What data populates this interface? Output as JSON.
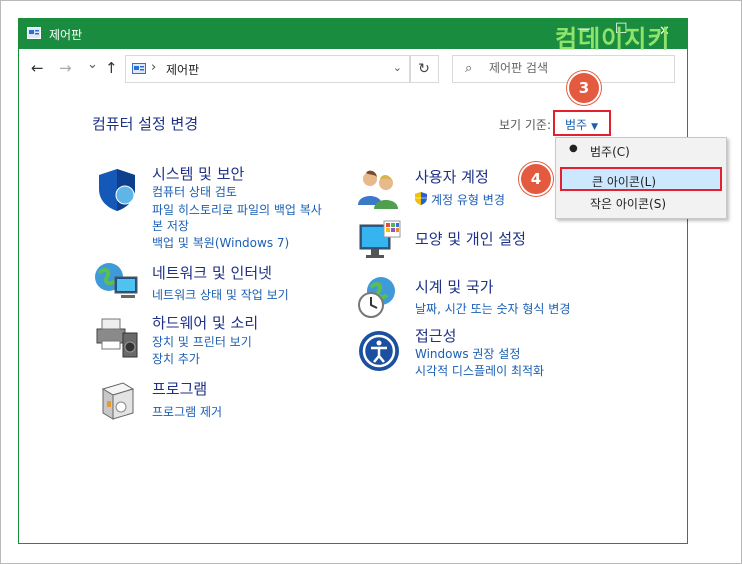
{
  "window": {
    "title": "제어판",
    "minimize": "—",
    "maximize": "☐",
    "close": "✕"
  },
  "watermark": "컴데이지키",
  "nav": {
    "back": "←",
    "forward": "→",
    "recent": "⌄",
    "up": "↑",
    "refresh": "↻",
    "path_sep": "›",
    "path": "제어판",
    "dropdown": "⌄"
  },
  "search": {
    "icon": "⌕",
    "placeholder": "제어판 검색"
  },
  "main": {
    "heading": "컴퓨터 설정 변경",
    "view_by_label": "보기 기준:",
    "view_by_value": "범주",
    "view_by_caret": "▼"
  },
  "menu": {
    "items": [
      {
        "label": "범주(C)",
        "selected": true
      },
      {
        "label": "큰 아이콘(L)",
        "highlighted": true
      },
      {
        "label": "작은 아이콘(S)"
      }
    ],
    "bullet": "●"
  },
  "badges": [
    "3",
    "4"
  ],
  "categories": {
    "system": {
      "title": "시스템 및 보안",
      "links": [
        "컴퓨터 상태 검토",
        "파일 히스토리로 파일의 백업 복사",
        "본 저장",
        "백업 및 복원(Windows 7)"
      ]
    },
    "network": {
      "title": "네트워크 및 인터넷",
      "links": [
        "네트워크 상태 및 작업 보기"
      ]
    },
    "hardware": {
      "title": "하드웨어 및 소리",
      "links": [
        "장치 및 프린터 보기",
        "장치 추가"
      ]
    },
    "programs": {
      "title": "프로그램",
      "links": [
        "프로그램 제거"
      ]
    },
    "users": {
      "title": "사용자 계정",
      "links": [
        "계정 유형 변경"
      ]
    },
    "appearance": {
      "title": "모양 및 개인 설정",
      "links": []
    },
    "clock": {
      "title": "시계 및 국가",
      "links": [
        "날짜, 시간 또는 숫자 형식 변경"
      ]
    },
    "access": {
      "title": "접근성",
      "links": [
        "Windows 권장 설정",
        "시각적 디스플레이 최적화"
      ]
    }
  },
  "colors": {
    "titlebar": "#1a8c3f",
    "link": "#1a5fb4",
    "heading": "#1e3287",
    "highlight_border": "#e5202e",
    "badge": "#e35a3f"
  }
}
